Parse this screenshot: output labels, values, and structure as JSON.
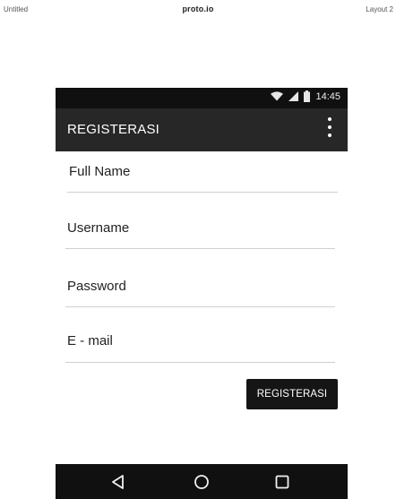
{
  "header": {
    "project_name": "Untitled",
    "brand": "proto.io",
    "layout_name": "Layout 2"
  },
  "status_bar": {
    "time": "14:45",
    "icons": [
      "wifi-icon",
      "signal-icon",
      "battery-icon"
    ]
  },
  "app_bar": {
    "title": "REGISTERASI",
    "menu_icon": "more-vert-icon"
  },
  "form": {
    "fields": [
      {
        "label": "Full Name"
      },
      {
        "label": "Username"
      },
      {
        "label": "Password"
      },
      {
        "label": "E - mail"
      }
    ],
    "submit_label": "REGISTERASI"
  },
  "nav_bar": {
    "icons": [
      "back-icon",
      "home-icon",
      "recents-icon"
    ]
  },
  "colors": {
    "status_bar": "#101010",
    "app_bar": "#272727",
    "button": "#151515",
    "divider": "#cfcfcf"
  }
}
